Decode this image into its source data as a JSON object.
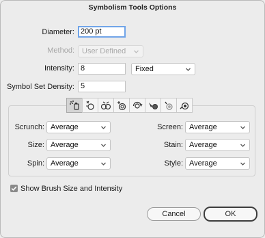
{
  "window": {
    "title": "Symbolism Tools Options"
  },
  "diameter": {
    "label": "Diameter:",
    "value": "200 pt"
  },
  "method": {
    "label": "Method:",
    "value": "User Defined"
  },
  "intensity": {
    "label": "Intensity:",
    "value": "8",
    "mode": "Fixed"
  },
  "density": {
    "label": "Symbol Set Density:",
    "value": "5"
  },
  "tools": [
    "symbol-sprayer-icon",
    "symbol-shifter-icon",
    "symbol-scruncher-icon",
    "symbol-sizer-icon",
    "symbol-spinner-icon",
    "symbol-stainer-icon",
    "symbol-screener-icon",
    "symbol-styler-icon"
  ],
  "options": {
    "left": [
      {
        "label": "Scrunch:",
        "value": "Average"
      },
      {
        "label": "Size:",
        "value": "Average"
      },
      {
        "label": "Spin:",
        "value": "Average"
      }
    ],
    "right": [
      {
        "label": "Screen:",
        "value": "Average"
      },
      {
        "label": "Stain:",
        "value": "Average"
      },
      {
        "label": "Style:",
        "value": "Average"
      }
    ]
  },
  "show_brush": {
    "label": "Show Brush Size and Intensity",
    "checked": true
  },
  "buttons": {
    "cancel": "Cancel",
    "ok": "OK"
  },
  "colors": {
    "focus_ring": "#70a4e8",
    "background": "#ececec"
  }
}
